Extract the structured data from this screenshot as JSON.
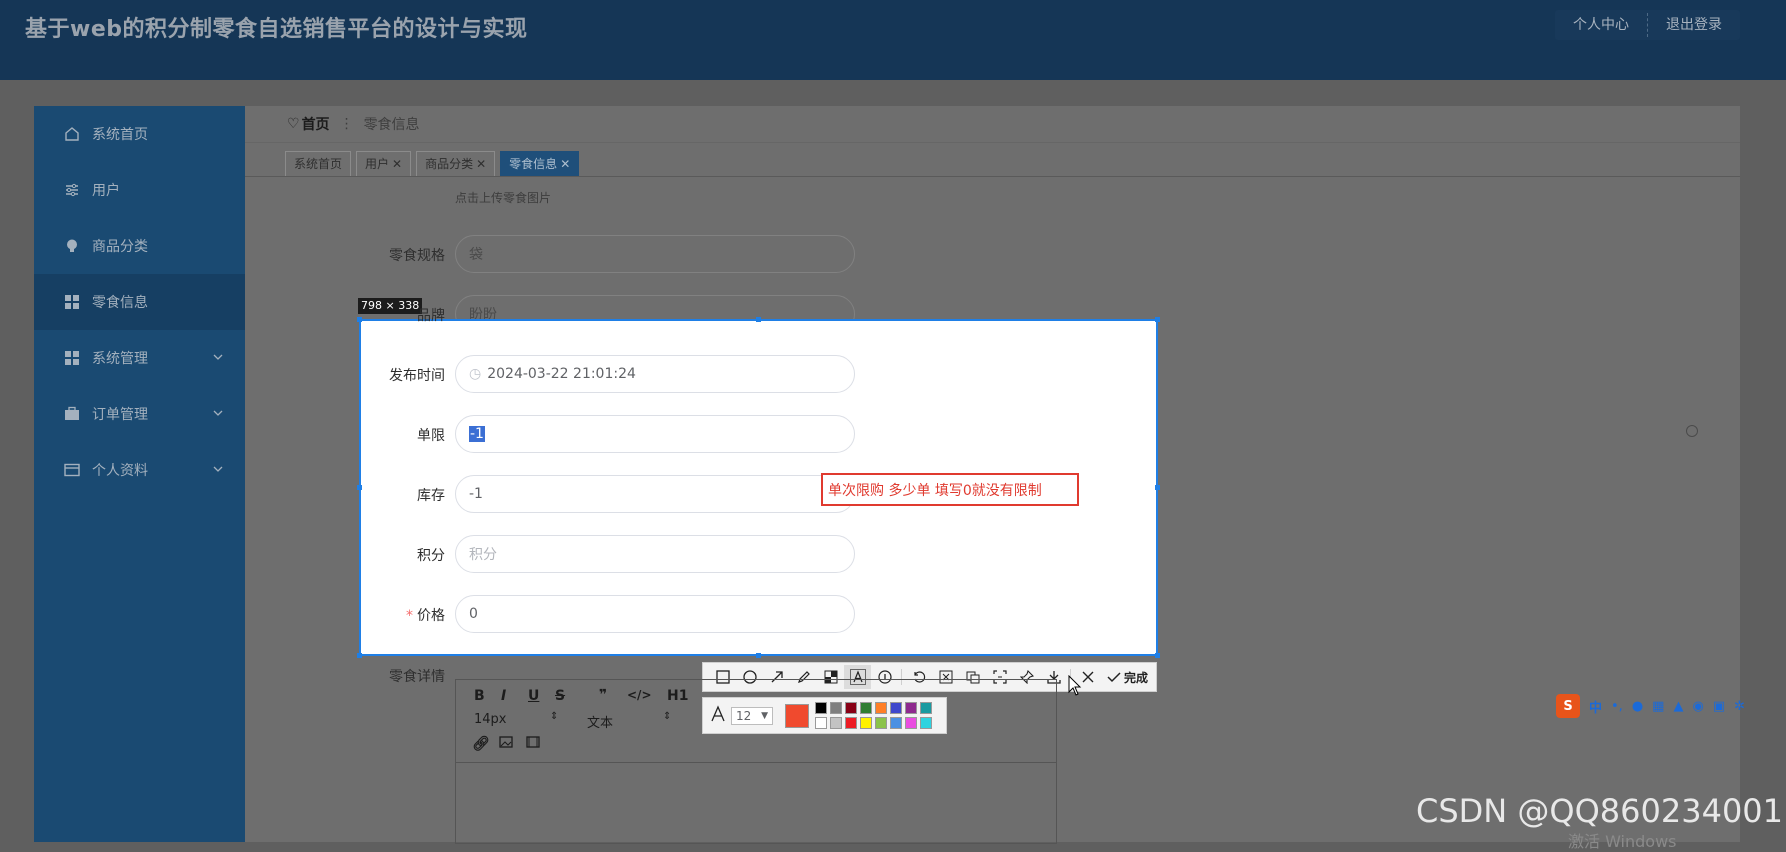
{
  "header": {
    "title": "基于web的积分制零食自选销售平台的设计与实现",
    "personal_center": "个人中心",
    "logout": "退出登录"
  },
  "sidebar": {
    "items": [
      {
        "label": "系统首页",
        "icon": "home-icon"
      },
      {
        "label": "用户",
        "icon": "sliders-icon"
      },
      {
        "label": "商品分类",
        "icon": "bulb-icon"
      },
      {
        "label": "零食信息",
        "icon": "grid-icon"
      },
      {
        "label": "系统管理",
        "icon": "grid-icon"
      },
      {
        "label": "订单管理",
        "icon": "briefcase-icon"
      },
      {
        "label": "个人资料",
        "icon": "card-icon"
      }
    ]
  },
  "breadcrumb": {
    "home": "首页",
    "sep": "⋮",
    "current": "零食信息"
  },
  "tabs": [
    {
      "label": "系统首页",
      "closable": false
    },
    {
      "label": "用户",
      "closable": true
    },
    {
      "label": "商品分类",
      "closable": true
    },
    {
      "label": "零食信息",
      "closable": true
    }
  ],
  "form": {
    "upload_hint": "点击上传零食图片",
    "spec": {
      "label": "零食规格",
      "placeholder": "袋"
    },
    "brand": {
      "label": "品牌",
      "placeholder": "盼盼"
    },
    "publish_time": {
      "label": "发布时间",
      "value": "2024-03-22 21:01:24"
    },
    "limit": {
      "label": "单限",
      "value": "-1"
    },
    "stock": {
      "label": "库存",
      "value": "-1"
    },
    "points": {
      "label": "积分",
      "placeholder": "积分"
    },
    "price": {
      "label": "价格",
      "value": "0",
      "required_mark": "*"
    },
    "detail": {
      "label": "零食详情"
    }
  },
  "screenshot_tool": {
    "size_badge": "798 × 338",
    "annotation": "单次限购 多少单 填写0就没有限制",
    "done": "完成",
    "font_size": "12",
    "current_color": "#f04a2e",
    "palette": [
      "#000000",
      "#7f7f7f",
      "#880015",
      "#2f7d32",
      "#ff7f27",
      "#3f48cc",
      "#8e2a8e",
      "#1a9aa0",
      "#ffffff",
      "#c3c3c3",
      "#ed1c24",
      "#fff200",
      "#8bc34a",
      "#4a90e2",
      "#e94de0",
      "#2ed3e0"
    ]
  },
  "editor": {
    "font_size": "14px",
    "paragraph": "文本",
    "heading": "H1"
  },
  "watermark": "CSDN @QQ860234001",
  "os_hint": "激活 Windows"
}
